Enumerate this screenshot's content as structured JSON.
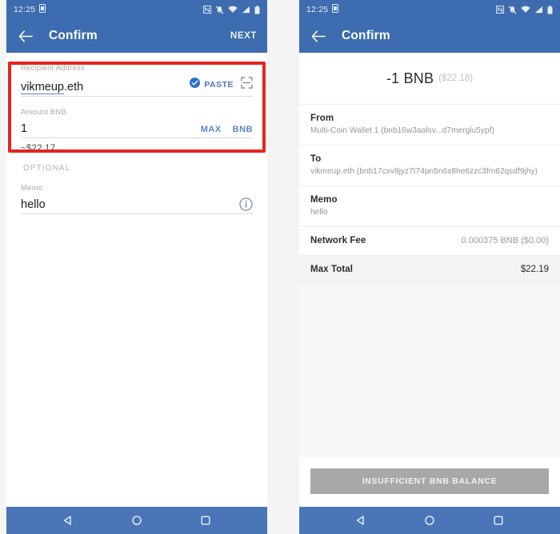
{
  "screen_left": {
    "status_bar": {
      "time": "12:25",
      "icons": [
        "sim-card-icon",
        "nfc-icon",
        "bell-muted-icon",
        "wifi-icon",
        "signal-icon",
        "battery-icon"
      ]
    },
    "app_bar": {
      "back_icon": "arrow-left-icon",
      "title": "Confirm",
      "action_label": "NEXT"
    },
    "recipient_field": {
      "label": "Recipient Address",
      "value": "vikmeup",
      "value_suffix": ".eth",
      "paste_label": "PASTE",
      "check_icon": "check-circle-icon",
      "scan_icon": "qr-scan-icon"
    },
    "amount_field": {
      "label": "Amount BNB",
      "value": "1",
      "max_label": "MAX",
      "unit_label": "BNB"
    },
    "fiat_estimate": "~$22.17",
    "optional_label": "OPTIONAL",
    "memo_field": {
      "label": "Memo",
      "value": "hello",
      "info_icon": "info-circle-icon"
    },
    "highlight": {
      "color": "#e5231c"
    },
    "nav_bar": {
      "back_icon": "triangle-back-icon",
      "home_icon": "circle-home-icon",
      "recents_icon": "square-recents-icon"
    }
  },
  "screen_right": {
    "status_bar": {
      "time": "12:25",
      "icons": [
        "sim-card-icon",
        "nfc-icon",
        "bell-muted-icon",
        "wifi-icon",
        "signal-icon",
        "battery-icon"
      ]
    },
    "app_bar": {
      "back_icon": "arrow-left-icon",
      "title": "Confirm"
    },
    "amount_hero": {
      "amount": "-1 BNB",
      "fiat": "($22.18)"
    },
    "rows": [
      {
        "title": "From",
        "sub": "Multi-Coin Wallet 1 (bnb16w3aalsv...d7merglu5ypf)"
      },
      {
        "title": "To",
        "sub": "vikmeup.eth (bnb17cxv8jyz7t74pn5n6x8he6zzc3fm62qsdf9jhy)"
      },
      {
        "title": "Memo",
        "sub": "hello"
      }
    ],
    "network_fee": {
      "label": "Network Fee",
      "value": "0.000375 BNB ($0.00)"
    },
    "max_total": {
      "label": "Max Total",
      "value": "$22.19"
    },
    "cta": {
      "label": "INSUFFICIENT BNB BALANCE",
      "enabled": false
    },
    "nav_bar": {
      "back_icon": "triangle-back-icon",
      "home_icon": "circle-home-icon",
      "recents_icon": "square-recents-icon"
    }
  },
  "theme": {
    "primary_blue": "#3d6cb0",
    "nav_blue": "#4a76b8",
    "accent_link": "#4a76bd",
    "highlight_red": "#e5231c",
    "disabled_grey": "#a8a8a8"
  }
}
